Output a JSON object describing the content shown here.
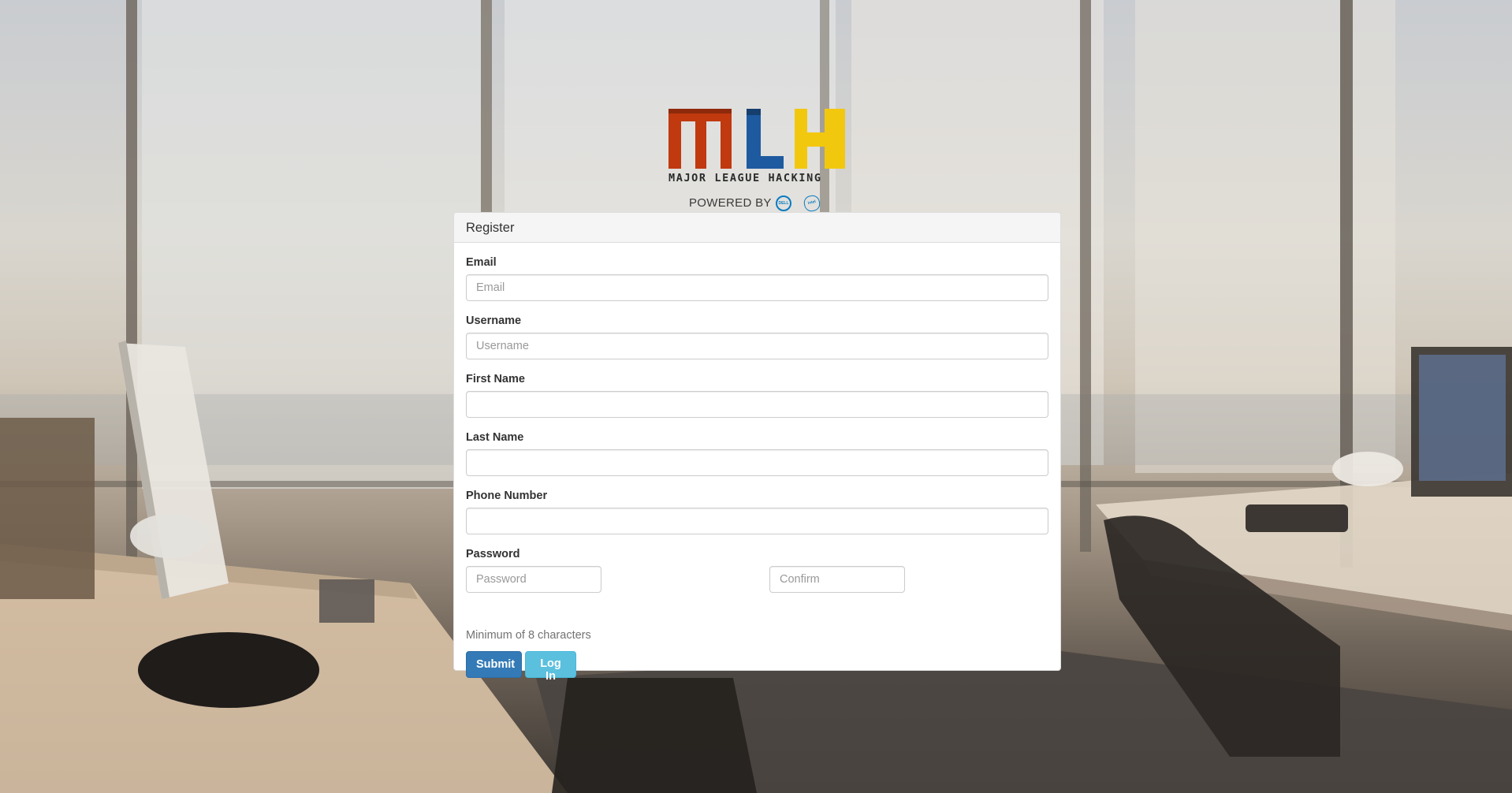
{
  "brand": {
    "logo_letters": [
      "M",
      "L",
      "H"
    ],
    "logo_colors": [
      "#c0390f",
      "#1e5aa0",
      "#f2c80f"
    ],
    "subtitle": "MAJOR LEAGUE HACKING",
    "powered_by": "POWERED BY",
    "partners": [
      {
        "name": "DELL",
        "icon": "dell-logo-icon"
      },
      {
        "name": "intel",
        "icon": "intel-logo-icon"
      }
    ]
  },
  "form": {
    "title": "Register",
    "fields": {
      "email": {
        "label": "Email",
        "placeholder": "Email",
        "value": ""
      },
      "username": {
        "label": "Username",
        "placeholder": "Username",
        "value": ""
      },
      "first_name": {
        "label": "First Name",
        "placeholder": "",
        "value": ""
      },
      "last_name": {
        "label": "Last Name",
        "placeholder": "",
        "value": ""
      },
      "phone": {
        "label": "Phone Number",
        "placeholder": "",
        "value": ""
      },
      "password": {
        "label": "Password",
        "placeholder": "Password",
        "value": ""
      },
      "confirm": {
        "placeholder": "Confirm",
        "value": ""
      }
    },
    "help_text": "Minimum of 8 characters",
    "submit_label": "Submit",
    "login_label": "Log In",
    "colors": {
      "primary": "#337ab7",
      "info": "#5bc0de"
    }
  }
}
